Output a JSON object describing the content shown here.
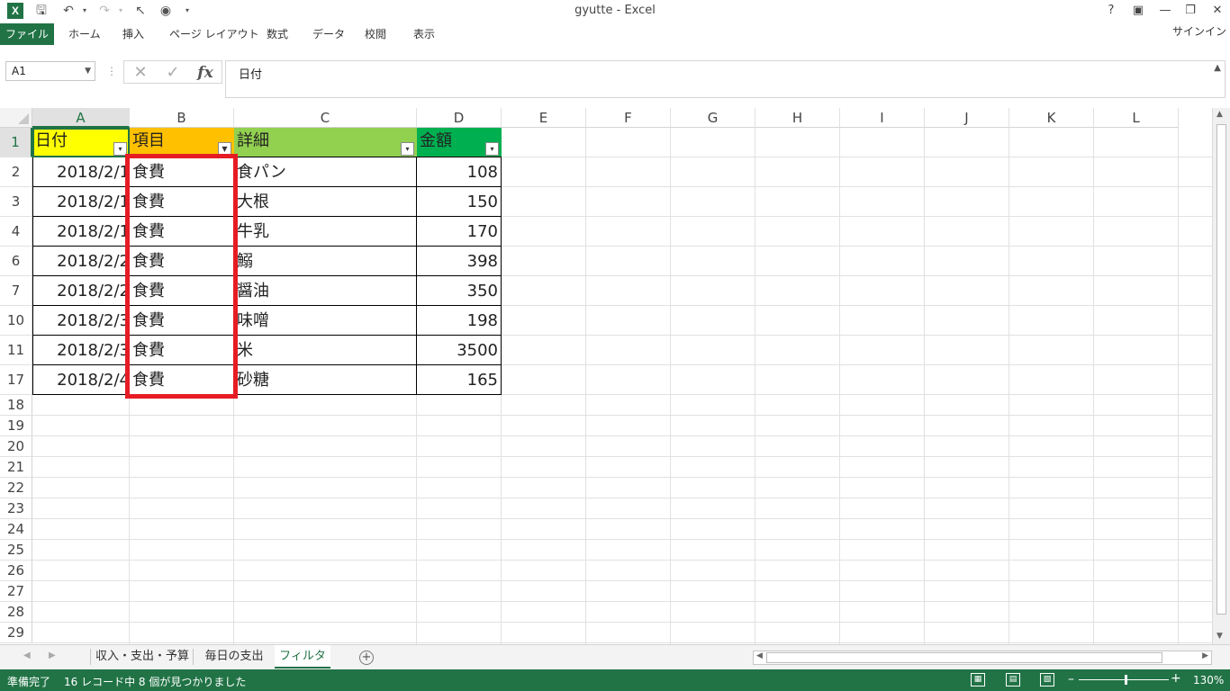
{
  "app": {
    "window_title": "gyutte - Excel",
    "logo": "X",
    "sign_in": "サインイン"
  },
  "quick_access": [
    "save-icon",
    "undo-icon",
    "redo-icon",
    "pointer-icon",
    "camera-icon"
  ],
  "window_controls": [
    "?",
    "restore-ribbon-icon",
    "minimize-icon",
    "restore-icon",
    "close-icon"
  ],
  "ribbon": {
    "tabs": [
      "ファイル",
      "ホーム",
      "挿入",
      "ページ レイアウト",
      "数式",
      "データ",
      "校閲",
      "表示"
    ]
  },
  "formula_bar": {
    "name_box": "A1",
    "content": "日付",
    "cancel_glyph": "✕",
    "enter_glyph": "✓",
    "fx_label": "fx"
  },
  "columns": [
    "A",
    "B",
    "C",
    "D",
    "E",
    "F",
    "G",
    "H",
    "I",
    "J",
    "K",
    "L"
  ],
  "table": {
    "headers": [
      {
        "label": "日付",
        "color": "#ffff00"
      },
      {
        "label": "項目",
        "color": "#ffc000"
      },
      {
        "label": "詳細",
        "color": "#92d050"
      },
      {
        "label": "金額",
        "color": "#00b050"
      }
    ],
    "rows": [
      {
        "row": "2",
        "date": "2018/2/1",
        "item": "食費",
        "detail": "食パン",
        "amount": "108"
      },
      {
        "row": "3",
        "date": "2018/2/1",
        "item": "食費",
        "detail": "大根",
        "amount": "150"
      },
      {
        "row": "4",
        "date": "2018/2/1",
        "item": "食費",
        "detail": "牛乳",
        "amount": "170"
      },
      {
        "row": "6",
        "date": "2018/2/2",
        "item": "食費",
        "detail": "鰯",
        "amount": "398"
      },
      {
        "row": "7",
        "date": "2018/2/2",
        "item": "食費",
        "detail": "醤油",
        "amount": "350"
      },
      {
        "row": "10",
        "date": "2018/2/3",
        "item": "食費",
        "detail": "味噌",
        "amount": "198"
      },
      {
        "row": "11",
        "date": "2018/2/3",
        "item": "食費",
        "detail": "米",
        "amount": "3500"
      },
      {
        "row": "17",
        "date": "2018/2/4",
        "item": "食費",
        "detail": "砂糖",
        "amount": "165"
      }
    ]
  },
  "empty_rows": [
    "18",
    "19",
    "20",
    "21",
    "22",
    "23",
    "24",
    "25",
    "26",
    "27",
    "28",
    "29"
  ],
  "sheet_tabs": [
    "収入・支出・予算",
    "毎日の支出",
    "フィルタ"
  ],
  "active_sheet": "フィルタ",
  "status": {
    "ready": "準備完了",
    "filter_message": "16 レコード中 8 個が見つかりました",
    "zoom": "130%"
  },
  "colors": {
    "accent": "#217346",
    "highlight_box": "#e61c24"
  }
}
